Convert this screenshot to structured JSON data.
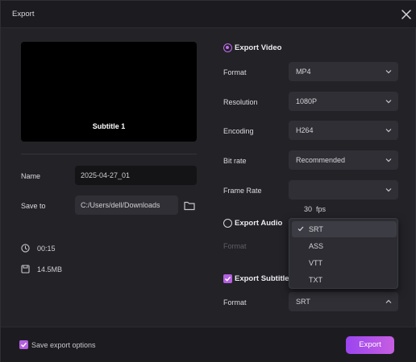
{
  "dialog": {
    "title": "Export"
  },
  "preview": {
    "subtitle": "Subtitle 1"
  },
  "name": {
    "label": "Name",
    "value": "2025-04-27_01"
  },
  "save_to": {
    "label": "Save to",
    "value": "C:/Users/dell/Downloads"
  },
  "meta": {
    "duration": "00:15",
    "size": "14.5MB"
  },
  "export_video": {
    "label": "Export Video",
    "selected": true,
    "fields": [
      {
        "label": "Format",
        "value": "MP4"
      },
      {
        "label": "Resolution",
        "value": "1080P"
      },
      {
        "label": "Encoding",
        "value": "H264"
      },
      {
        "label": "Bit rate",
        "value": "Recommended"
      },
      {
        "label": "Frame Rate",
        "value": "30  fps"
      }
    ]
  },
  "export_audio": {
    "label": "Export Audio",
    "selected": false,
    "format_label": "Format"
  },
  "subtitle_dropdown": {
    "options": [
      "SRT",
      "ASS",
      "VTT",
      "TXT"
    ],
    "selected": "SRT"
  },
  "export_subtitles": {
    "label": "Export Subtitles",
    "checked": true,
    "format_label": "Format",
    "format_value": "SRT"
  },
  "footer": {
    "save_options_label": "Save export options",
    "save_options_checked": true,
    "export_label": "Export"
  },
  "colors": {
    "accent": "#b45fe0",
    "button_gradient_start": "#9b45f0",
    "button_gradient_end": "#c65ee0"
  }
}
